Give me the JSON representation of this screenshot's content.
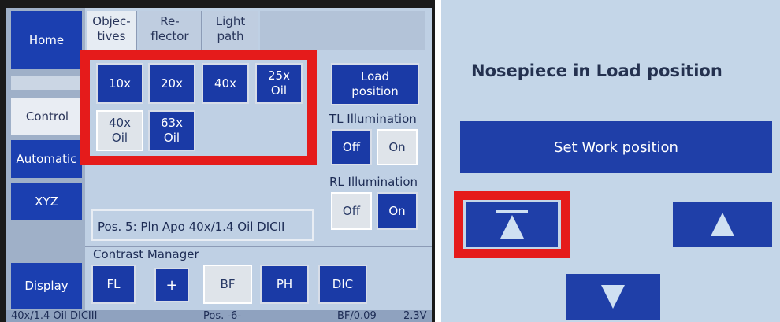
{
  "left": {
    "sidebar": {
      "home": "Home",
      "control": "Control",
      "automatic": "Automatic",
      "xyz": "XYZ",
      "display": "Display"
    },
    "tabs": [
      {
        "label": "Objec-\ntives"
      },
      {
        "label": "Re-\nflector"
      },
      {
        "label": "Light\npath"
      }
    ],
    "objectives": [
      {
        "label": "10x",
        "selected": false
      },
      {
        "label": "20x",
        "selected": false
      },
      {
        "label": "40x",
        "selected": false
      },
      {
        "label": "25x\nOil",
        "selected": false
      },
      {
        "label": "40x\nOil",
        "selected": true
      },
      {
        "label": "63x\nOil",
        "selected": false
      }
    ],
    "load_position": "Load\nposition",
    "tl_illumination": {
      "label": "TL Illumination",
      "off": "Off",
      "on": "On",
      "active": "Off"
    },
    "rl_illumination": {
      "label": "RL Illumination",
      "off": "Off",
      "on": "On",
      "active": "On"
    },
    "position_text": "Pos. 5: Pln Apo 40x/1.4 Oil DICII",
    "contrast_manager": {
      "label": "Contrast Manager",
      "buttons": [
        {
          "label": "FL"
        },
        {
          "label": "+"
        },
        {
          "label": "BF",
          "selected": true
        },
        {
          "label": "PH"
        },
        {
          "label": "DIC"
        }
      ]
    },
    "status_bar": {
      "objective": "40x/1.4 Oil DICIII",
      "pos": "Pos. -6-",
      "mode": "BF/0.09",
      "voltage": "2.3V"
    }
  },
  "right": {
    "title": "Nosepiece in Load position",
    "work_button": "Set Work position",
    "icons": {
      "load_up": "load-position-up-icon",
      "up": "arrow-up-icon",
      "down": "arrow-down-icon"
    }
  },
  "colors": {
    "button_blue": "#1a3aa6",
    "highlight_red": "#e51b1b",
    "panel_light": "#c4d6e8"
  }
}
